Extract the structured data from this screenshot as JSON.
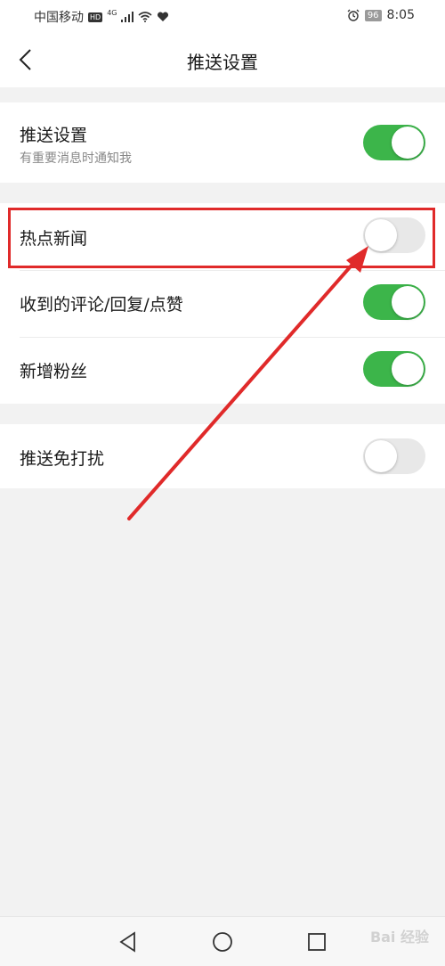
{
  "status_bar": {
    "carrier": "中国移动",
    "hd_badge": "HD",
    "network_type": "4G",
    "battery_level": "96",
    "time": "8:05"
  },
  "nav": {
    "title": "推送设置"
  },
  "settings": {
    "push": {
      "label": "推送设置",
      "sublabel": "有重要消息时通知我",
      "enabled": true
    },
    "hot_news": {
      "label": "热点新闻",
      "enabled": false
    },
    "comments": {
      "label": "收到的评论/回复/点赞",
      "enabled": true
    },
    "new_fans": {
      "label": "新增粉丝",
      "enabled": true
    },
    "dnd": {
      "label": "推送免打扰",
      "enabled": false
    }
  },
  "colors": {
    "toggle_on": "#3cb54a",
    "toggle_off": "#e8e8e8",
    "annotation": "#e02a2a"
  },
  "watermark": "Bai 经验"
}
